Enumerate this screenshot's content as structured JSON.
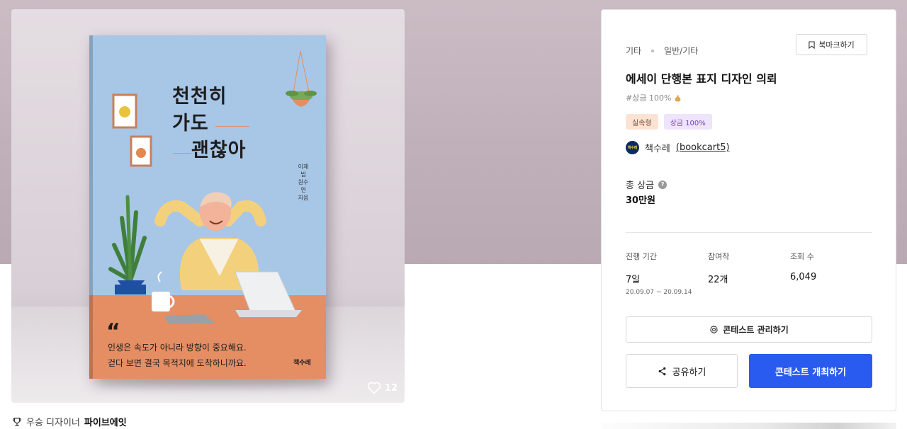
{
  "cover": {
    "title_line1": "천천히",
    "title_line2": "가도",
    "title_line3": "괜찮아",
    "author": "이재범 원수연 지음",
    "quote_mark": "“",
    "quote_line1": "인생은 속도가 아니라 방향이 중요해요.",
    "quote_line2": "걷다 보면 결국 목적지에 도착하니까요.",
    "publisher": "책수레"
  },
  "likes": {
    "count": "12"
  },
  "winner": {
    "prefix": "우승 디자이너",
    "name": "파이브에잇"
  },
  "panel": {
    "breadcrumb": [
      "기타",
      "일반/기타"
    ],
    "bookmark_label": "북마크하기",
    "title": "에세이 단행본 표지 디자인 의뢰",
    "hashtag": "#상금 100%",
    "tags": [
      "실속형",
      "상금 100%"
    ],
    "host": {
      "avatar_text": "책수레",
      "name": "책수레",
      "handle": "(bookcart5)"
    },
    "prize_label": "총 상금",
    "prize_help": "?",
    "prize_value": "30만원",
    "stats": {
      "period_label": "진행 기간",
      "period_value": "7일",
      "period_range": "20.09.07  ~  20.09.14",
      "entries_label": "참여작",
      "entries_value": "22개",
      "views_label": "조회 수",
      "views_value": "6,049"
    },
    "manage_label": "콘테스트 관리하기",
    "share_label": "공유하기",
    "host_contest_label": "콘테스트 개최하기"
  },
  "colors": {
    "accent": "#2a5bf0",
    "cover_sky": "#a8c6e6",
    "cover_desk": "#e58d63"
  }
}
